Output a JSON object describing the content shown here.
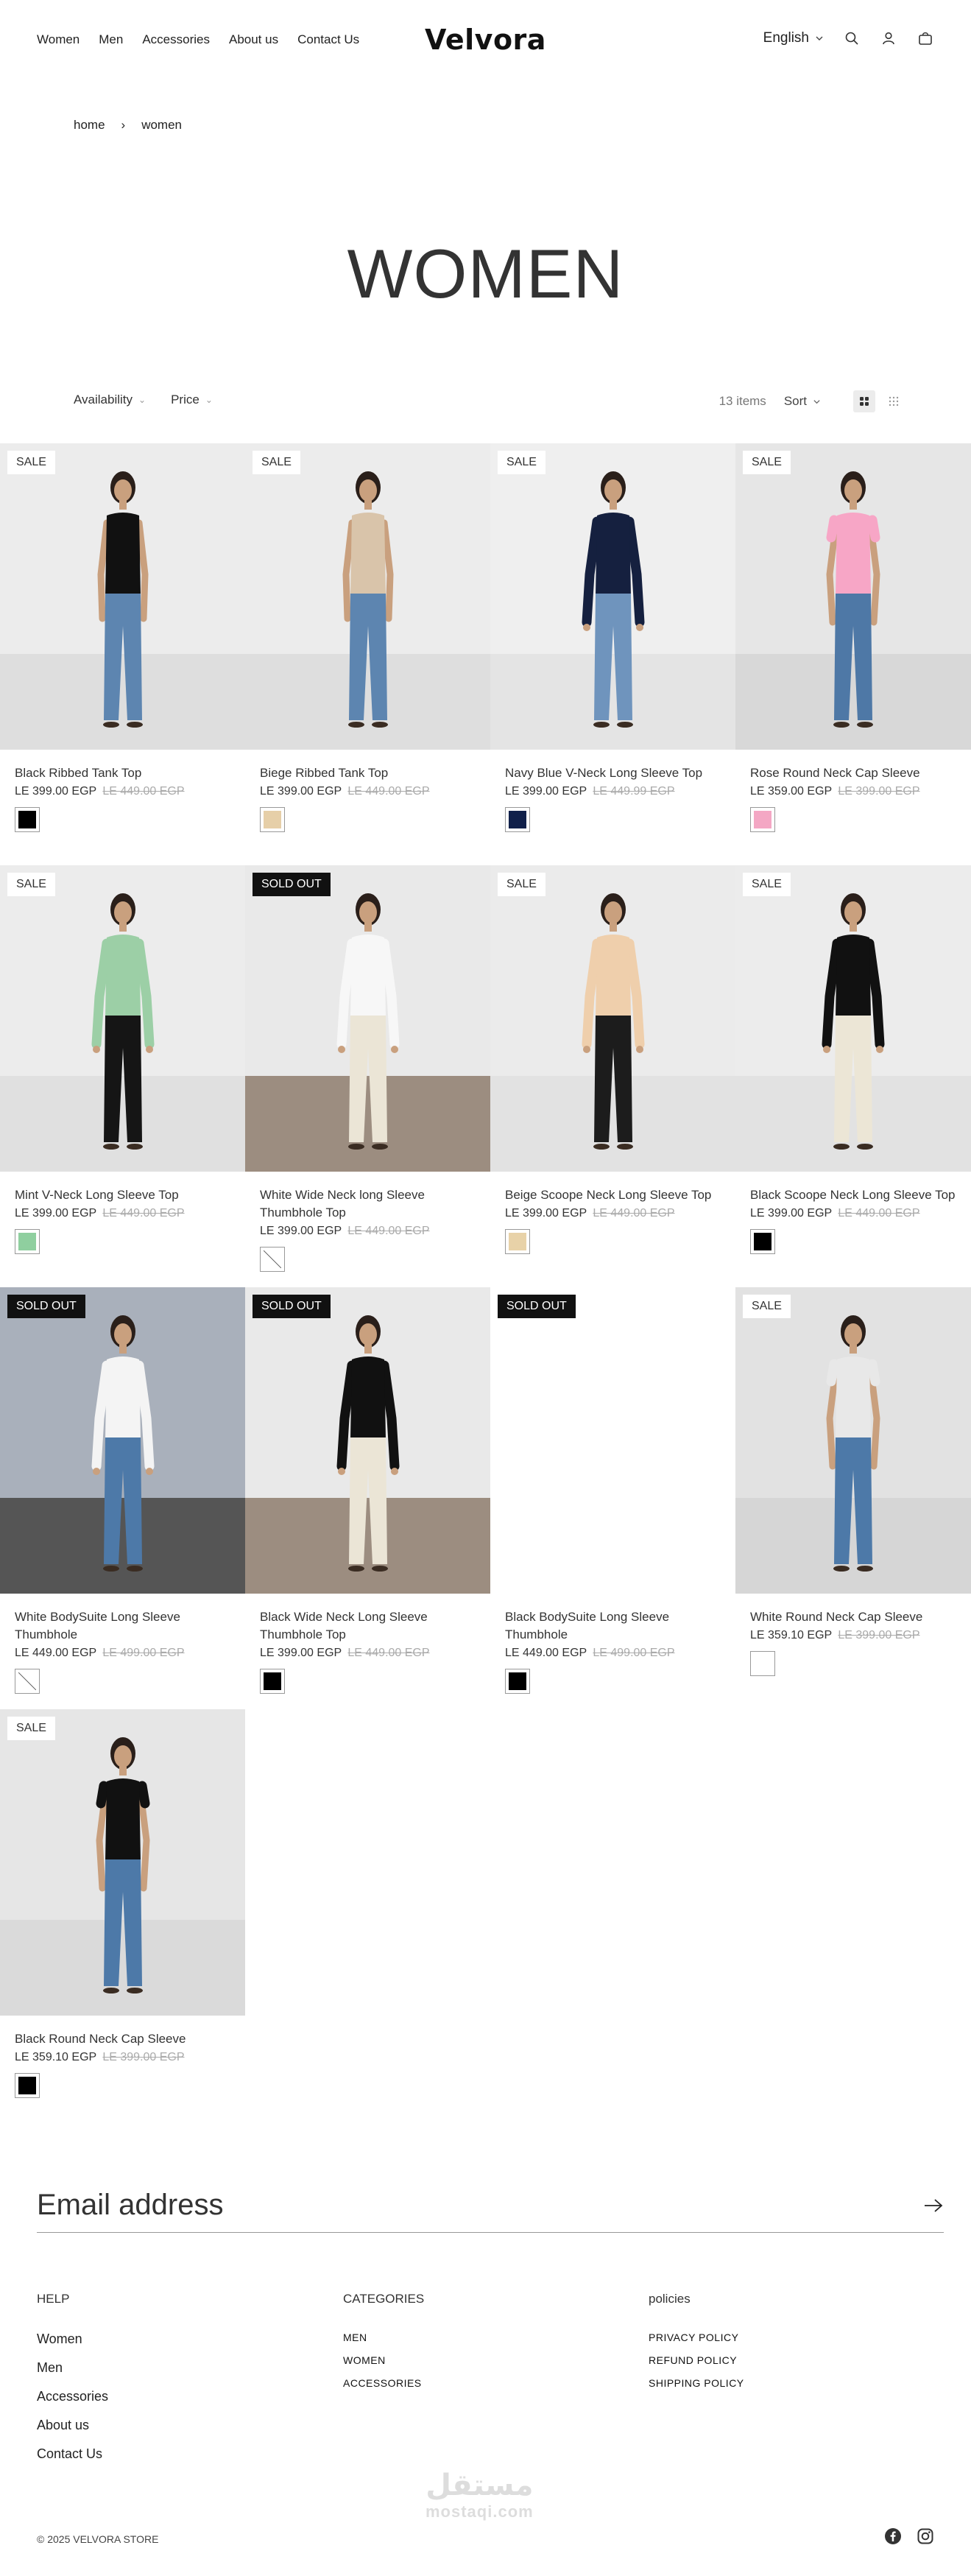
{
  "header": {
    "nav": [
      "Women",
      "Men",
      "Accessories",
      "About us",
      "Contact Us"
    ],
    "logo": "Velvora",
    "language": "English"
  },
  "breadcrumb": {
    "home": "home",
    "separator": "›",
    "current": "women"
  },
  "page_title": "WOMEN",
  "toolbar": {
    "filter_availability": "Availability",
    "filter_price": "Price",
    "item_count": "13 items",
    "sort_label": "Sort"
  },
  "products": [
    {
      "badge": "SALE",
      "title": "Black Ribbed Tank Top",
      "price": "LE 399.00 EGP",
      "old_price": "LE 449.00 EGP",
      "swatch": "#000000",
      "bg": "#ececec",
      "floor": "#dedede",
      "top": "#111111",
      "bottom": "#5d85b0",
      "sleeves": "none"
    },
    {
      "badge": "SALE",
      "title": "Biege Ribbed Tank Top",
      "price": "LE 399.00 EGP",
      "old_price": "LE 449.00 EGP",
      "swatch": "#e6cfa8",
      "bg": "#ececec",
      "floor": "#dedede",
      "top": "#d9c4aa",
      "bottom": "#5d85b0",
      "sleeves": "none"
    },
    {
      "badge": "SALE",
      "title": "Navy Blue V-Neck Long Sleeve Top",
      "price": "LE 399.00 EGP",
      "old_price": "LE 449.99 EGP",
      "swatch": "#10204a",
      "bg": "#efefef",
      "floor": "#e4e4e4",
      "top": "#15203f",
      "bottom": "#6f94bd",
      "sleeves": "long"
    },
    {
      "badge": "SALE",
      "title": "Rose Round Neck Cap Sleeve",
      "price": "LE 359.00 EGP",
      "old_price": "LE 399.00 EGP",
      "swatch": "#f4a7c4",
      "bg": "#e6e6e6",
      "floor": "#d8d8d8",
      "top": "#f7a6c6",
      "bottom": "#4e78a6",
      "sleeves": "cap"
    },
    {
      "badge": "SALE",
      "title": "Mint V-Neck Long Sleeve Top",
      "price": "LE 399.00 EGP",
      "old_price": "LE 449.00 EGP",
      "swatch": "#8fcf9f",
      "bg": "#ececec",
      "floor": "#e0e0e0",
      "top": "#9ccfa6",
      "bottom": "#151515",
      "sleeves": "long"
    },
    {
      "badge": "SOLD OUT",
      "title": "White Wide Neck long Sleeve Thumbhole Top",
      "price": "LE 399.00 EGP",
      "old_price": "LE 449.00 EGP",
      "swatch": "",
      "bg": "#e9e9e9",
      "floor": "#9c8d80",
      "top": "#f7f7f7",
      "bottom": "#ebe5d6",
      "sleeves": "long"
    },
    {
      "badge": "SALE",
      "title": "Beige Scoope Neck Long Sleeve Top",
      "price": "LE 399.00 EGP",
      "old_price": "LE 449.00 EGP",
      "swatch": "#e8d2a8",
      "bg": "#ebebeb",
      "floor": "#e2e2e2",
      "top": "#efcfac",
      "bottom": "#1c1c1c",
      "sleeves": "long"
    },
    {
      "badge": "SALE",
      "title": "Black Scoope Neck Long Sleeve Top",
      "price": "LE 399.00 EGP",
      "old_price": "LE 449.00 EGP",
      "swatch": "#000000",
      "bg": "#ececec",
      "floor": "#e2e2e2",
      "top": "#111111",
      "bottom": "#ece6d6",
      "sleeves": "long"
    },
    {
      "badge": "SOLD OUT",
      "title": "White BodySuite Long Sleeve Thumbhole",
      "price": "LE 449.00 EGP",
      "old_price": "LE 499.00 EGP",
      "swatch": "",
      "bg": "#a9b0bb",
      "floor": "#555555",
      "top": "#f4f4f4",
      "bottom": "#4d79a8",
      "sleeves": "long"
    },
    {
      "badge": "SOLD OUT",
      "title": "Black Wide Neck Long Sleeve Thumbhole Top",
      "price": "LE 399.00 EGP",
      "old_price": "LE 449.00 EGP",
      "swatch": "#000000",
      "bg": "#e9e9e9",
      "floor": "#9c8d80",
      "top": "#111111",
      "bottom": "#ebe5d6",
      "sleeves": "long"
    },
    {
      "badge": "SOLD OUT",
      "title": "Black BodySuite Long Sleeve Thumbhole",
      "price": "LE 449.00 EGP",
      "old_price": "LE 499.00 EGP",
      "swatch": "#000000",
      "bg": "#ffffff",
      "floor": "#ffffff",
      "top": "",
      "bottom": "",
      "sleeves": "blank"
    },
    {
      "badge": "SALE",
      "title": "White Round Neck Cap Sleeve",
      "price": "LE 359.10 EGP",
      "old_price": "LE 399.00 EGP",
      "swatch": "#ffffff",
      "bg": "#e2e2e2",
      "floor": "#d6d6d6",
      "top": "#e8e8e8",
      "bottom": "#4d79a8",
      "sleeves": "cap"
    },
    {
      "badge": "SALE",
      "title": "Black Round Neck Cap Sleeve",
      "price": "LE 359.10 EGP",
      "old_price": "LE 399.00 EGP",
      "swatch": "#000000",
      "bg": "#e6e6e6",
      "floor": "#dadada",
      "top": "#111111",
      "bottom": "#4d79a8",
      "sleeves": "cap"
    }
  ],
  "footer": {
    "email_label": "Email address",
    "help_head": "HELP",
    "help_links": [
      "Women",
      "Men",
      "Accessories",
      "About us",
      "Contact Us"
    ],
    "categories_head": "CATEGORIES",
    "categories_links": [
      "MEN",
      "WOMEN",
      "ACCESSORIES"
    ],
    "policies_head": "policies",
    "policies_links": [
      "PRIVACY POLICY",
      "REFUND POLICY",
      "SHIPPING POLICY"
    ],
    "copyright": "© 2025 VELVORA STORE",
    "watermark_ar": "مستقل",
    "watermark_en": "mostaqi.com"
  }
}
